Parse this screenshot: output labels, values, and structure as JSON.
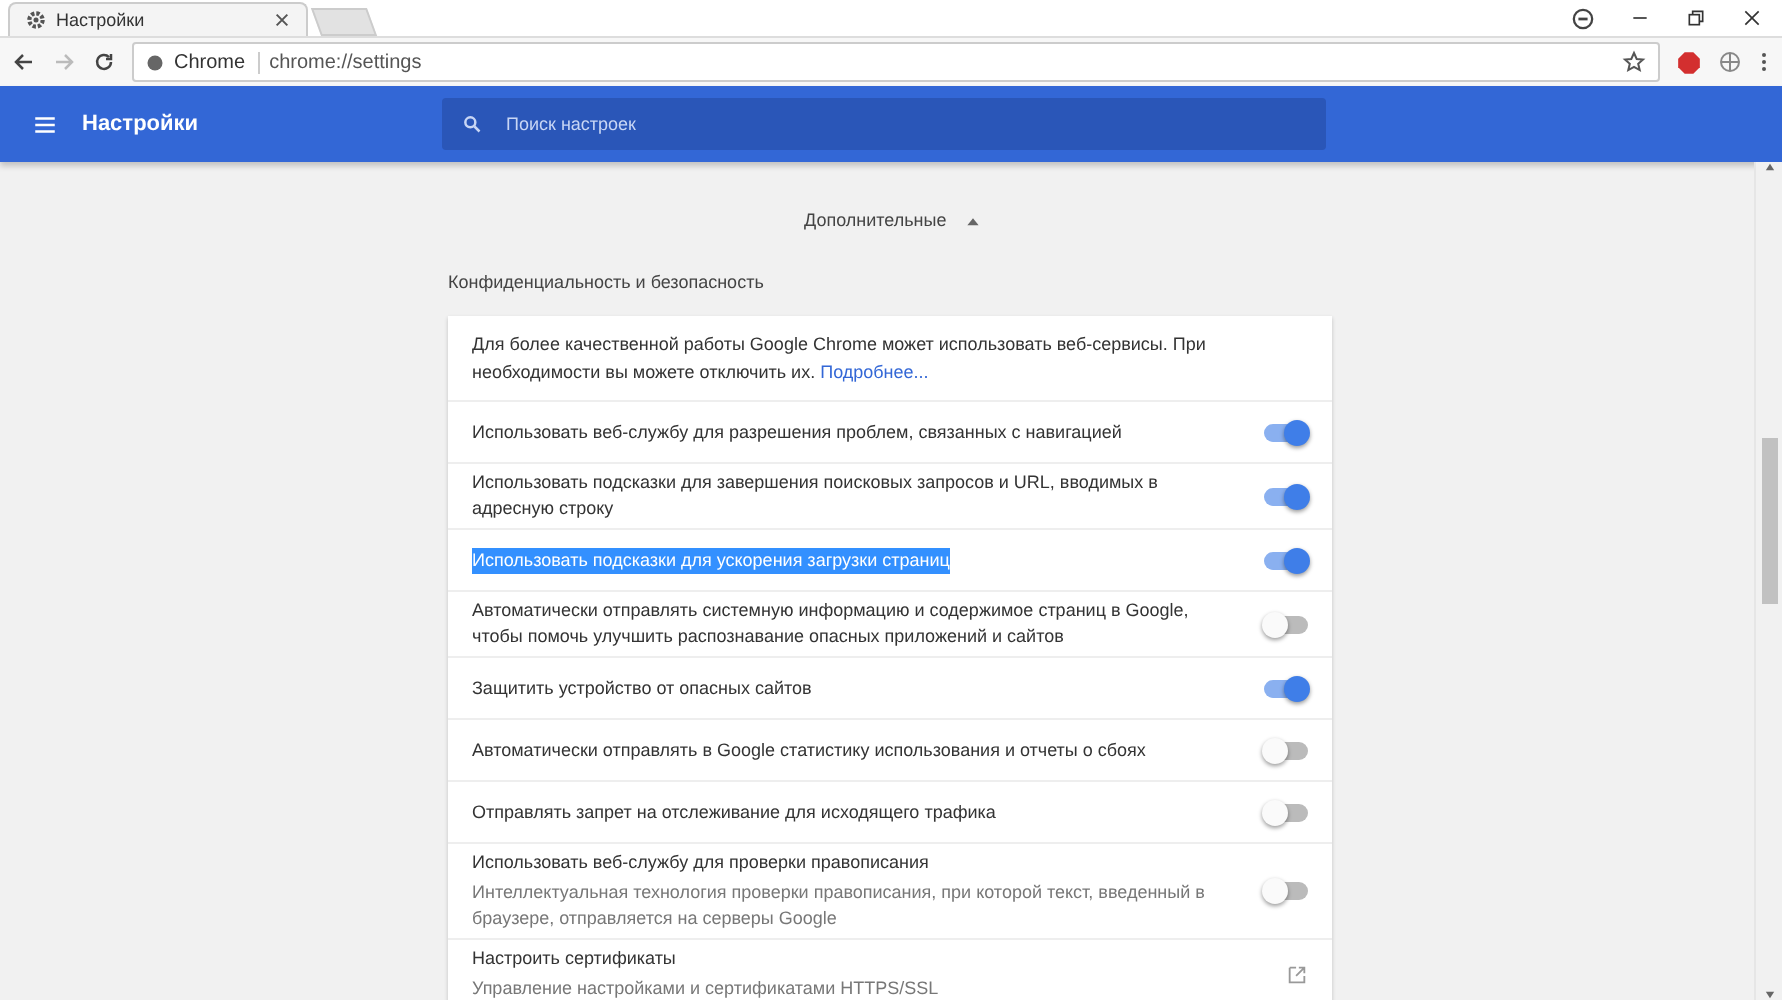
{
  "browser": {
    "tab_title": "Настройки",
    "address_origin": "Chrome",
    "address_url": "chrome://settings"
  },
  "header": {
    "title": "Настройки",
    "search_placeholder": "Поиск настроек"
  },
  "advanced": {
    "label": "Дополнительные",
    "expanded": true
  },
  "section": {
    "title": "Конфиденциальность и безопасность",
    "rows": [
      {
        "kind": "text",
        "text": "Для более качественной работы Google Chrome может использовать веб-сервисы. При необходимости вы можете отключить их.",
        "link": "Подробнее..."
      },
      {
        "kind": "toggle",
        "text": "Использовать веб-службу для разрешения проблем, связанных с навигацией",
        "on": true,
        "highlighted": false
      },
      {
        "kind": "toggle",
        "text": "Использовать подсказки для завершения поисковых запросов и URL, вводимых в адресную строку",
        "on": true,
        "highlighted": false
      },
      {
        "kind": "toggle",
        "text": "Использовать подсказки для ускорения загрузки страниц",
        "on": true,
        "highlighted": true
      },
      {
        "kind": "toggle",
        "text": "Автоматически отправлять системную информацию и содержимое страниц в Google, чтобы помочь улучшить распознавание опасных приложений и сайтов",
        "on": false,
        "highlighted": false
      },
      {
        "kind": "toggle",
        "text": "Защитить устройство от опасных сайтов",
        "on": true,
        "highlighted": false
      },
      {
        "kind": "toggle",
        "text": "Автоматически отправлять в Google статистику использования и отчеты о сбоях",
        "on": false,
        "highlighted": false
      },
      {
        "kind": "toggle",
        "text": "Отправлять запрет на отслеживание для исходящего трафика",
        "on": false,
        "highlighted": false
      },
      {
        "kind": "toggle",
        "text": "Использовать веб-службу для проверки правописания",
        "sub": "Интеллектуальная технология проверки правописания, при которой текст, введенный в браузере, отправляется на серверы Google",
        "on": false,
        "highlighted": false
      },
      {
        "kind": "link",
        "text": "Настроить сертификаты",
        "sub": "Управление настройками и сертификатами HTTPS/SSL"
      }
    ]
  }
}
